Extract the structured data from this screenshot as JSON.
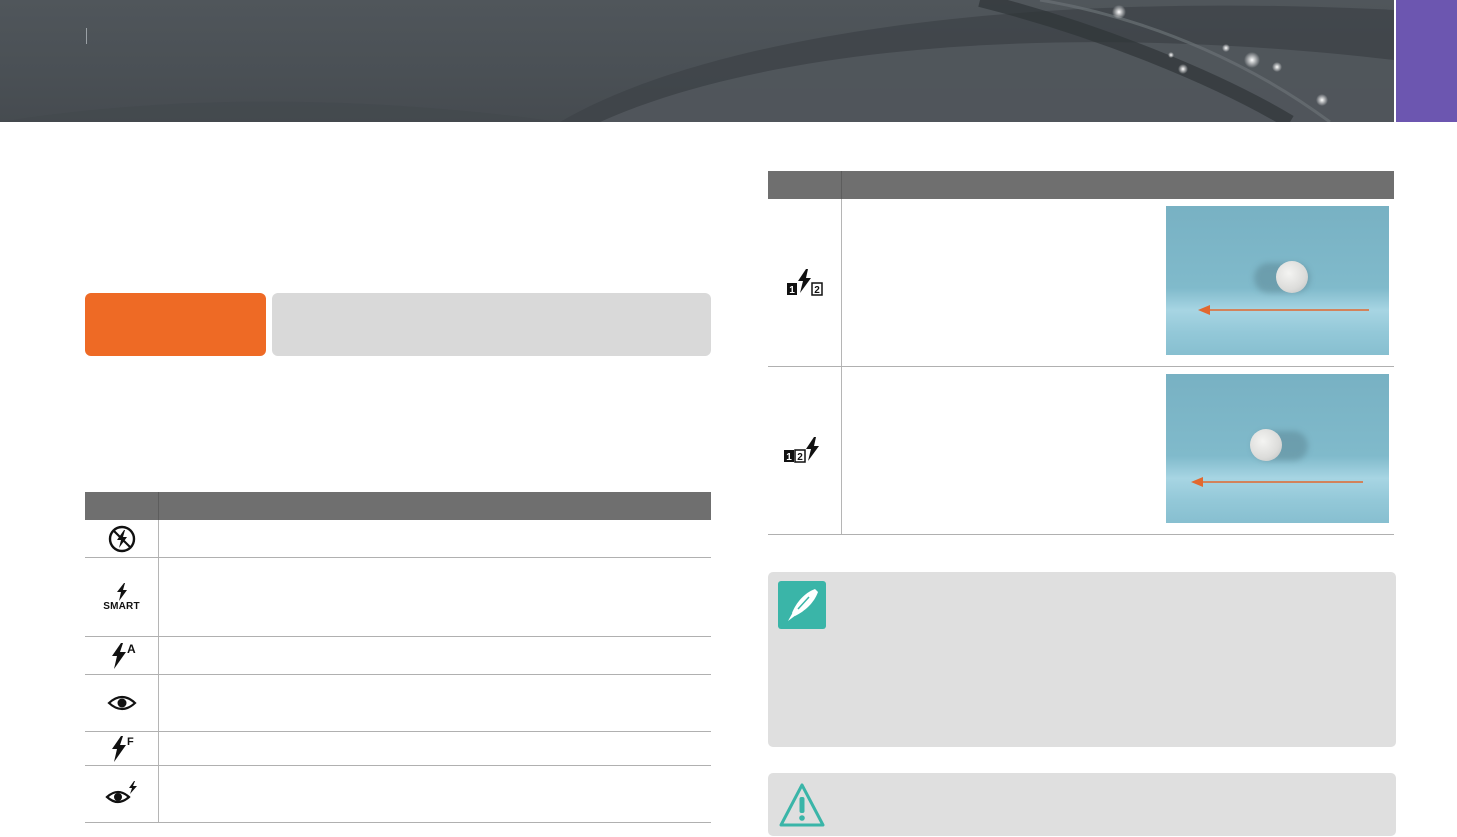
{
  "header": {
    "band_color": "#4b5156",
    "tab_color": "#6c56b0"
  },
  "left_table": {
    "header_color": "#6f6f6f",
    "rows": [
      {
        "icon": "flash-off-icon"
      },
      {
        "icon": "smart-flash-icon",
        "icon_text": "SMART"
      },
      {
        "icon": "auto-flash-icon",
        "icon_text": "A"
      },
      {
        "icon": "red-eye-icon"
      },
      {
        "icon": "fill-in-flash-icon",
        "icon_text": "F"
      },
      {
        "icon": "red-eye-fix-icon"
      }
    ]
  },
  "right_table": {
    "header_color": "#6f6f6f",
    "rows": [
      {
        "icon": "1st-curtain-icon",
        "icon_text": [
          "1",
          "2"
        ],
        "photo": "ball-motion-photo"
      },
      {
        "icon": "2nd-curtain-icon",
        "icon_text": [
          "1",
          "2"
        ],
        "photo": "ball-motion-photo"
      }
    ],
    "arrow_color": "#e2682e"
  },
  "notes": [
    {
      "icon": "note-pen-icon",
      "icon_color": "#3ab5a8"
    },
    {
      "icon": "warning-icon",
      "icon_color": "#3ab5a8"
    }
  ],
  "accent_colors": {
    "orange": "#ee6a25",
    "gray_pill": "#d9d9d9"
  }
}
